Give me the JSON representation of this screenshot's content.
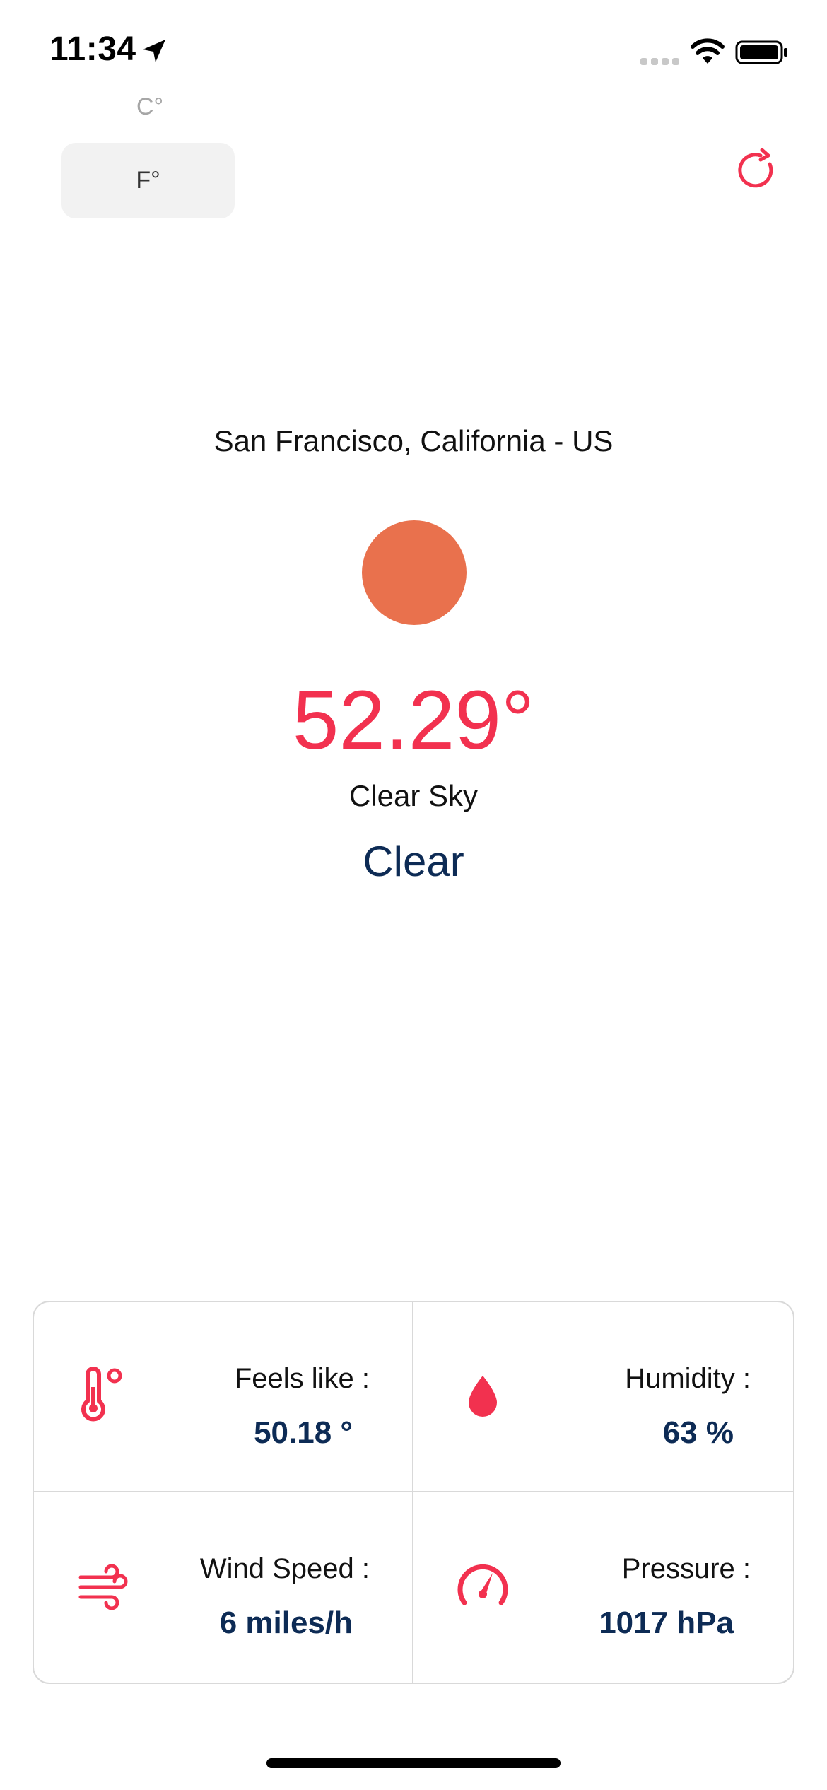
{
  "status_bar": {
    "time": "11:34"
  },
  "units": {
    "celsius_label": "C°",
    "fahrenheit_label": "F°"
  },
  "weather": {
    "location": "San Francisco, California - US",
    "temperature": "52.29°",
    "description": "Clear Sky",
    "main": "Clear"
  },
  "details": [
    {
      "label": "Feels like :",
      "value": "50.18 °",
      "icon": "thermometer-icon"
    },
    {
      "label": "Humidity :",
      "value": "63 %",
      "icon": "water-drop-icon"
    },
    {
      "label": "Wind Speed :",
      "value": "6 miles/h",
      "icon": "wind-icon"
    },
    {
      "label": "Pressure :",
      "value": "1017 hPa",
      "icon": "speedometer-icon"
    }
  ],
  "colors": {
    "accent": "#f2314f",
    "navy": "#0d2b55",
    "sun": "#e9714d",
    "button_bg": "#f2f2f2"
  }
}
